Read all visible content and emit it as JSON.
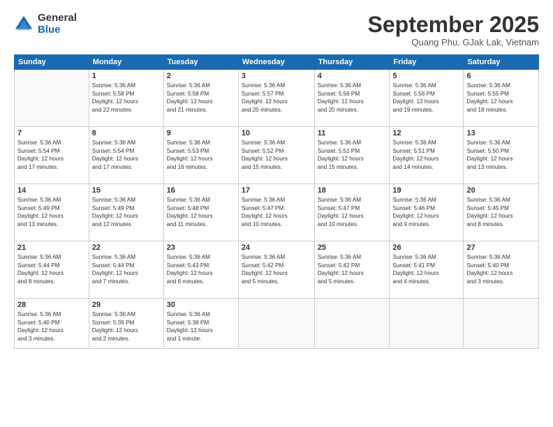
{
  "logo": {
    "general": "General",
    "blue": "Blue"
  },
  "header": {
    "title": "September 2025",
    "subtitle": "Quang Phu, GJak Lak, Vietnam"
  },
  "weekdays": [
    "Sunday",
    "Monday",
    "Tuesday",
    "Wednesday",
    "Thursday",
    "Friday",
    "Saturday"
  ],
  "weeks": [
    [
      {
        "day": "",
        "info": ""
      },
      {
        "day": "1",
        "info": "Sunrise: 5:36 AM\nSunset: 5:58 PM\nDaylight: 12 hours\nand 22 minutes."
      },
      {
        "day": "2",
        "info": "Sunrise: 5:36 AM\nSunset: 5:58 PM\nDaylight: 12 hours\nand 21 minutes."
      },
      {
        "day": "3",
        "info": "Sunrise: 5:36 AM\nSunset: 5:57 PM\nDaylight: 12 hours\nand 20 minutes."
      },
      {
        "day": "4",
        "info": "Sunrise: 5:36 AM\nSunset: 5:56 PM\nDaylight: 12 hours\nand 20 minutes."
      },
      {
        "day": "5",
        "info": "Sunrise: 5:36 AM\nSunset: 5:56 PM\nDaylight: 12 hours\nand 19 minutes."
      },
      {
        "day": "6",
        "info": "Sunrise: 5:36 AM\nSunset: 5:55 PM\nDaylight: 12 hours\nand 18 minutes."
      }
    ],
    [
      {
        "day": "7",
        "info": "Sunrise: 5:36 AM\nSunset: 5:54 PM\nDaylight: 12 hours\nand 17 minutes."
      },
      {
        "day": "8",
        "info": "Sunrise: 5:36 AM\nSunset: 5:54 PM\nDaylight: 12 hours\nand 17 minutes."
      },
      {
        "day": "9",
        "info": "Sunrise: 5:36 AM\nSunset: 5:53 PM\nDaylight: 12 hours\nand 16 minutes."
      },
      {
        "day": "10",
        "info": "Sunrise: 5:36 AM\nSunset: 5:52 PM\nDaylight: 12 hours\nand 15 minutes."
      },
      {
        "day": "11",
        "info": "Sunrise: 5:36 AM\nSunset: 5:51 PM\nDaylight: 12 hours\nand 15 minutes."
      },
      {
        "day": "12",
        "info": "Sunrise: 5:36 AM\nSunset: 5:51 PM\nDaylight: 12 hours\nand 14 minutes."
      },
      {
        "day": "13",
        "info": "Sunrise: 5:36 AM\nSunset: 5:50 PM\nDaylight: 12 hours\nand 13 minutes."
      }
    ],
    [
      {
        "day": "14",
        "info": "Sunrise: 5:36 AM\nSunset: 5:49 PM\nDaylight: 12 hours\nand 13 minutes."
      },
      {
        "day": "15",
        "info": "Sunrise: 5:36 AM\nSunset: 5:49 PM\nDaylight: 12 hours\nand 12 minutes."
      },
      {
        "day": "16",
        "info": "Sunrise: 5:36 AM\nSunset: 5:48 PM\nDaylight: 12 hours\nand 11 minutes."
      },
      {
        "day": "17",
        "info": "Sunrise: 5:36 AM\nSunset: 5:47 PM\nDaylight: 12 hours\nand 10 minutes."
      },
      {
        "day": "18",
        "info": "Sunrise: 5:36 AM\nSunset: 5:47 PM\nDaylight: 12 hours\nand 10 minutes."
      },
      {
        "day": "19",
        "info": "Sunrise: 5:36 AM\nSunset: 5:46 PM\nDaylight: 12 hours\nand 9 minutes."
      },
      {
        "day": "20",
        "info": "Sunrise: 5:36 AM\nSunset: 5:45 PM\nDaylight: 12 hours\nand 8 minutes."
      }
    ],
    [
      {
        "day": "21",
        "info": "Sunrise: 5:36 AM\nSunset: 5:44 PM\nDaylight: 12 hours\nand 8 minutes."
      },
      {
        "day": "22",
        "info": "Sunrise: 5:36 AM\nSunset: 5:44 PM\nDaylight: 12 hours\nand 7 minutes."
      },
      {
        "day": "23",
        "info": "Sunrise: 5:36 AM\nSunset: 5:43 PM\nDaylight: 12 hours\nand 6 minutes."
      },
      {
        "day": "24",
        "info": "Sunrise: 5:36 AM\nSunset: 5:42 PM\nDaylight: 12 hours\nand 5 minutes."
      },
      {
        "day": "25",
        "info": "Sunrise: 5:36 AM\nSunset: 5:42 PM\nDaylight: 12 hours\nand 5 minutes."
      },
      {
        "day": "26",
        "info": "Sunrise: 5:36 AM\nSunset: 5:41 PM\nDaylight: 12 hours\nand 4 minutes."
      },
      {
        "day": "27",
        "info": "Sunrise: 5:36 AM\nSunset: 5:40 PM\nDaylight: 12 hours\nand 3 minutes."
      }
    ],
    [
      {
        "day": "28",
        "info": "Sunrise: 5:36 AM\nSunset: 5:40 PM\nDaylight: 12 hours\nand 3 minutes."
      },
      {
        "day": "29",
        "info": "Sunrise: 5:36 AM\nSunset: 5:39 PM\nDaylight: 12 hours\nand 2 minutes."
      },
      {
        "day": "30",
        "info": "Sunrise: 5:36 AM\nSunset: 5:38 PM\nDaylight: 12 hours\nand 1 minute."
      },
      {
        "day": "",
        "info": ""
      },
      {
        "day": "",
        "info": ""
      },
      {
        "day": "",
        "info": ""
      },
      {
        "day": "",
        "info": ""
      }
    ]
  ]
}
